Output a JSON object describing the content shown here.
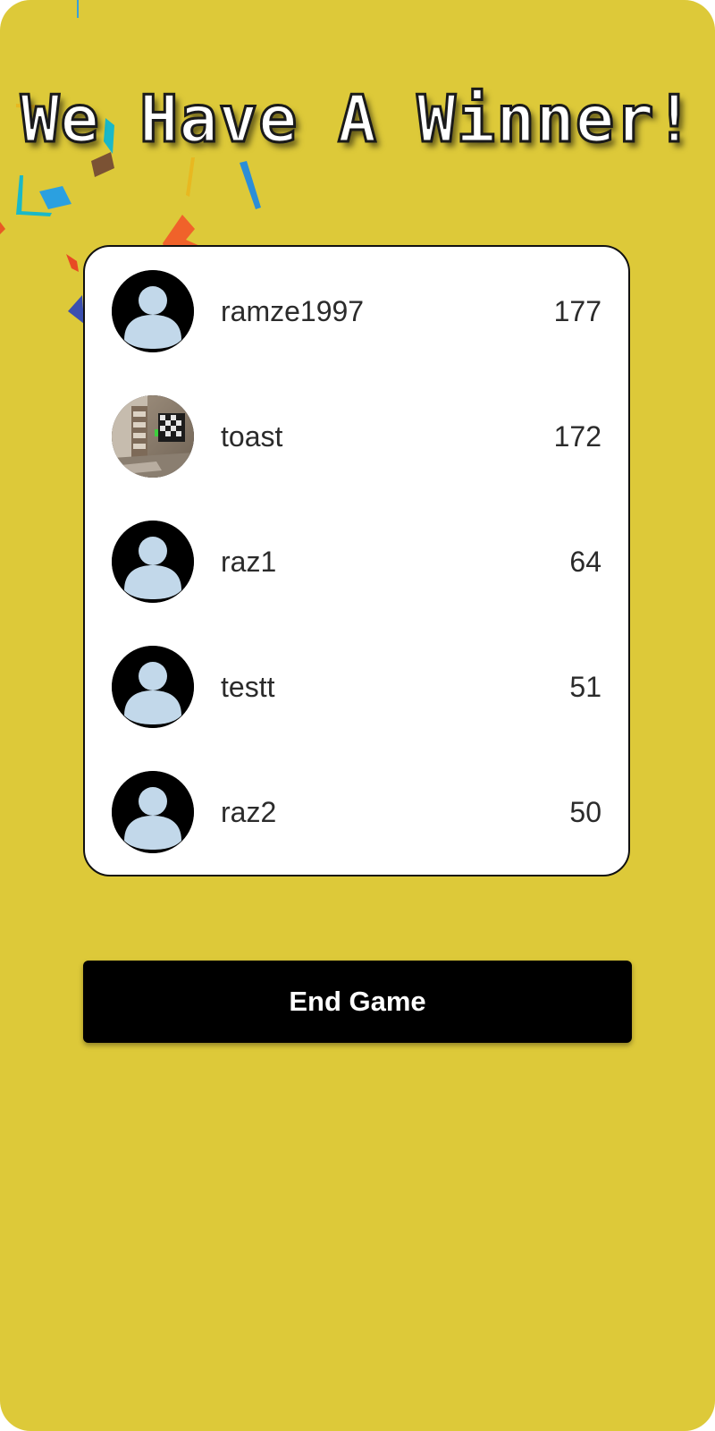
{
  "title": "We Have A Winner!",
  "leaderboard": [
    {
      "name": "ramze1997",
      "score": "177",
      "avatar": "default-user-icon"
    },
    {
      "name": "toast",
      "score": "172",
      "avatar": "photo-room-interior"
    },
    {
      "name": "raz1",
      "score": "64",
      "avatar": "default-user-icon"
    },
    {
      "name": "testt",
      "score": "51",
      "avatar": "default-user-icon"
    },
    {
      "name": "raz2",
      "score": "50",
      "avatar": "default-user-icon"
    }
  ],
  "end_button": {
    "label": "End Game"
  },
  "colors": {
    "background": "#ddc939",
    "card": "#ffffff",
    "button": "#000000",
    "avatar_figure": "#c2d8ea"
  }
}
